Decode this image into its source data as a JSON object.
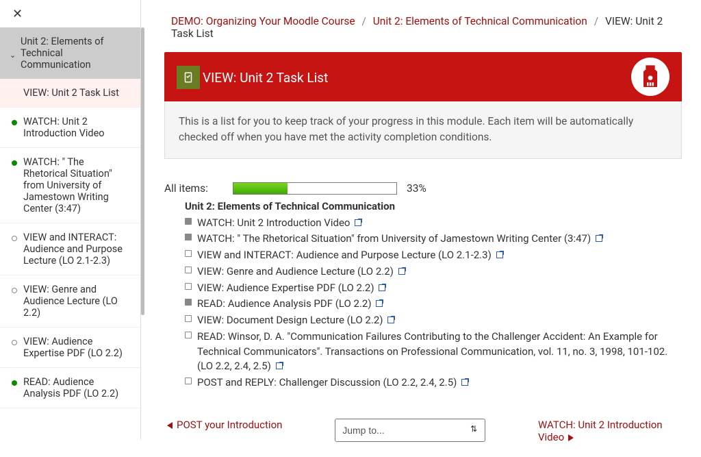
{
  "sidebar": {
    "section_title": "Unit 2: Elements of Technical Communication",
    "items": [
      {
        "label": "VIEW: Unit 2 Task List",
        "status": "active",
        "dot": "none"
      },
      {
        "label": "WATCH: Unit 2 Introduction Video",
        "status": "",
        "dot": "filled"
      },
      {
        "label": "WATCH: \" The Rhetorical Situation\" from University of Jamestown Writing Center (3:47)",
        "status": "",
        "dot": "filled"
      },
      {
        "label": "VIEW and INTERACT: Audience and Purpose Lecture (LO 2.1-2.3)",
        "status": "",
        "dot": "empty"
      },
      {
        "label": "VIEW: Genre and Audience Lecture (LO 2.2)",
        "status": "",
        "dot": "empty"
      },
      {
        "label": "VIEW: Audience Expertise PDF (LO 2.2)",
        "status": "",
        "dot": "empty"
      },
      {
        "label": "READ: Audience Analysis PDF (LO 2.2)",
        "status": "",
        "dot": "filled"
      }
    ]
  },
  "breadcrumb": {
    "a": "DEMO: Organizing Your Moodle Course",
    "b": "Unit 2: Elements of Technical Communication",
    "c": "VIEW: Unit 2 Task List"
  },
  "header": {
    "title": "VIEW: Unit 2 Task List"
  },
  "intro": "This is a list for you to keep track of your progress in this module. Each item will be automatically checked off when you have met the activity completion conditions.",
  "progress": {
    "label": "All items:",
    "percent": 33,
    "percent_text": "33%"
  },
  "checklist": {
    "heading": "Unit 2: Elements of Technical Communication",
    "items": [
      {
        "checked": true,
        "text": "WATCH: Unit 2 Introduction Video"
      },
      {
        "checked": true,
        "text": "WATCH: \" The Rhetorical Situation\" from University of Jamestown Writing Center (3:47)"
      },
      {
        "checked": false,
        "text": "VIEW and INTERACT: Audience and Purpose Lecture (LO 2.1-2.3)"
      },
      {
        "checked": false,
        "text": "VIEW: Genre and Audience Lecture (LO 2.2)"
      },
      {
        "checked": false,
        "text": "VIEW: Audience Expertise PDF (LO 2.2)"
      },
      {
        "checked": true,
        "text": "READ: Audience Analysis PDF (LO 2.2)"
      },
      {
        "checked": false,
        "text": "VIEW: Document Design Lecture (LO 2.2)"
      },
      {
        "checked": false,
        "text": "READ: Winsor, D. A. \"Communication Failures Contributing to the Challenger Accident: An Example for Technical Communicators\". Transactions on Professional Communication, vol. 11, no. 3, 1998, 101-102. (LO 2.2, 2.4, 2.5)"
      },
      {
        "checked": false,
        "text": "POST and REPLY: Challenger Discussion (LO 2.2, 2.4, 2.5)"
      }
    ]
  },
  "bottomnav": {
    "prev": "POST your Introduction",
    "next": "WATCH: Unit 2 Introduction Video",
    "jump": "Jump to..."
  }
}
